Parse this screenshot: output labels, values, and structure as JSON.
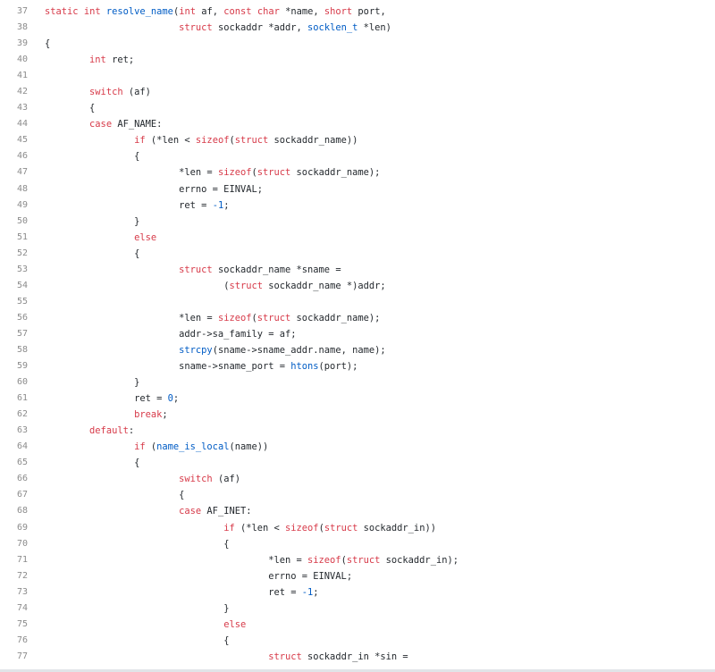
{
  "colors": {
    "keyword": "#d73a49",
    "function": "#005cc5",
    "number": "#005cc5",
    "plain": "#24292e",
    "line_number": "#8c8c8c"
  },
  "lines": [
    {
      "n": "37",
      "indent": "",
      "t": [
        [
          "kw",
          "static"
        ],
        [
          "p",
          " "
        ],
        [
          "kw",
          "int"
        ],
        [
          "p",
          " "
        ],
        [
          "fn",
          "resolve_name"
        ],
        [
          "p",
          "("
        ],
        [
          "kw",
          "int"
        ],
        [
          "p",
          " af, "
        ],
        [
          "kw",
          "const"
        ],
        [
          "p",
          " "
        ],
        [
          "kw",
          "char"
        ],
        [
          "p",
          " *name, "
        ],
        [
          "kw",
          "short"
        ],
        [
          "p",
          " port,"
        ]
      ]
    },
    {
      "n": "38",
      "indent": "\t\t\t",
      "t": [
        [
          "kw",
          "struct"
        ],
        [
          "p",
          " sockaddr *addr, "
        ],
        [
          "fn",
          "socklen_t"
        ],
        [
          "p",
          " *len)"
        ]
      ]
    },
    {
      "n": "39",
      "indent": "",
      "t": [
        [
          "p",
          "{"
        ]
      ]
    },
    {
      "n": "40",
      "indent": "\t",
      "t": [
        [
          "kw",
          "int"
        ],
        [
          "p",
          " ret;"
        ]
      ]
    },
    {
      "n": "41",
      "indent": "",
      "t": []
    },
    {
      "n": "42",
      "indent": "\t",
      "t": [
        [
          "kw",
          "switch"
        ],
        [
          "p",
          " (af)"
        ]
      ]
    },
    {
      "n": "43",
      "indent": "\t",
      "t": [
        [
          "p",
          "{"
        ]
      ]
    },
    {
      "n": "44",
      "indent": "\t",
      "t": [
        [
          "kw",
          "case"
        ],
        [
          "p",
          " AF_NAME:"
        ]
      ]
    },
    {
      "n": "45",
      "indent": "\t\t",
      "t": [
        [
          "kw",
          "if"
        ],
        [
          "p",
          " (*len < "
        ],
        [
          "kw",
          "sizeof"
        ],
        [
          "p",
          "("
        ],
        [
          "kw",
          "struct"
        ],
        [
          "p",
          " sockaddr_name))"
        ]
      ]
    },
    {
      "n": "46",
      "indent": "\t\t",
      "t": [
        [
          "p",
          "{"
        ]
      ]
    },
    {
      "n": "47",
      "indent": "\t\t\t",
      "t": [
        [
          "p",
          "*len = "
        ],
        [
          "kw",
          "sizeof"
        ],
        [
          "p",
          "("
        ],
        [
          "kw",
          "struct"
        ],
        [
          "p",
          " sockaddr_name);"
        ]
      ]
    },
    {
      "n": "48",
      "indent": "\t\t\t",
      "t": [
        [
          "p",
          "errno = EINVAL;"
        ]
      ]
    },
    {
      "n": "49",
      "indent": "\t\t\t",
      "t": [
        [
          "p",
          "ret = "
        ],
        [
          "num",
          "-1"
        ],
        [
          "p",
          ";"
        ]
      ]
    },
    {
      "n": "50",
      "indent": "\t\t",
      "t": [
        [
          "p",
          "}"
        ]
      ]
    },
    {
      "n": "51",
      "indent": "\t\t",
      "t": [
        [
          "kw",
          "else"
        ]
      ]
    },
    {
      "n": "52",
      "indent": "\t\t",
      "t": [
        [
          "p",
          "{"
        ]
      ]
    },
    {
      "n": "53",
      "indent": "\t\t\t",
      "t": [
        [
          "kw",
          "struct"
        ],
        [
          "p",
          " sockaddr_name *sname ="
        ]
      ]
    },
    {
      "n": "54",
      "indent": "\t\t\t\t",
      "t": [
        [
          "p",
          "("
        ],
        [
          "kw",
          "struct"
        ],
        [
          "p",
          " sockaddr_name *)addr;"
        ]
      ]
    },
    {
      "n": "55",
      "indent": "",
      "t": []
    },
    {
      "n": "56",
      "indent": "\t\t\t",
      "t": [
        [
          "p",
          "*len = "
        ],
        [
          "kw",
          "sizeof"
        ],
        [
          "p",
          "("
        ],
        [
          "kw",
          "struct"
        ],
        [
          "p",
          " sockaddr_name);"
        ]
      ]
    },
    {
      "n": "57",
      "indent": "\t\t\t",
      "t": [
        [
          "p",
          "addr->sa_family = af;"
        ]
      ]
    },
    {
      "n": "58",
      "indent": "\t\t\t",
      "t": [
        [
          "fn",
          "strcpy"
        ],
        [
          "p",
          "(sname->sname_addr.name, name);"
        ]
      ]
    },
    {
      "n": "59",
      "indent": "\t\t\t",
      "t": [
        [
          "p",
          "sname->sname_port = "
        ],
        [
          "fn",
          "htons"
        ],
        [
          "p",
          "(port);"
        ]
      ]
    },
    {
      "n": "60",
      "indent": "\t\t",
      "t": [
        [
          "p",
          "}"
        ]
      ]
    },
    {
      "n": "61",
      "indent": "\t\t",
      "t": [
        [
          "p",
          "ret = "
        ],
        [
          "num",
          "0"
        ],
        [
          "p",
          ";"
        ]
      ]
    },
    {
      "n": "62",
      "indent": "\t\t",
      "t": [
        [
          "kw",
          "break"
        ],
        [
          "p",
          ";"
        ]
      ]
    },
    {
      "n": "63",
      "indent": "\t",
      "t": [
        [
          "kw",
          "default"
        ],
        [
          "p",
          ":"
        ]
      ]
    },
    {
      "n": "64",
      "indent": "\t\t",
      "t": [
        [
          "kw",
          "if"
        ],
        [
          "p",
          " ("
        ],
        [
          "fn",
          "name_is_local"
        ],
        [
          "p",
          "(name))"
        ]
      ]
    },
    {
      "n": "65",
      "indent": "\t\t",
      "t": [
        [
          "p",
          "{"
        ]
      ]
    },
    {
      "n": "66",
      "indent": "\t\t\t",
      "t": [
        [
          "kw",
          "switch"
        ],
        [
          "p",
          " (af)"
        ]
      ]
    },
    {
      "n": "67",
      "indent": "\t\t\t",
      "t": [
        [
          "p",
          "{"
        ]
      ]
    },
    {
      "n": "68",
      "indent": "\t\t\t",
      "t": [
        [
          "kw",
          "case"
        ],
        [
          "p",
          " AF_INET:"
        ]
      ]
    },
    {
      "n": "69",
      "indent": "\t\t\t\t",
      "t": [
        [
          "kw",
          "if"
        ],
        [
          "p",
          " (*len < "
        ],
        [
          "kw",
          "sizeof"
        ],
        [
          "p",
          "("
        ],
        [
          "kw",
          "struct"
        ],
        [
          "p",
          " sockaddr_in))"
        ]
      ]
    },
    {
      "n": "70",
      "indent": "\t\t\t\t",
      "t": [
        [
          "p",
          "{"
        ]
      ]
    },
    {
      "n": "71",
      "indent": "\t\t\t\t\t",
      "t": [
        [
          "p",
          "*len = "
        ],
        [
          "kw",
          "sizeof"
        ],
        [
          "p",
          "("
        ],
        [
          "kw",
          "struct"
        ],
        [
          "p",
          " sockaddr_in);"
        ]
      ]
    },
    {
      "n": "72",
      "indent": "\t\t\t\t\t",
      "t": [
        [
          "p",
          "errno = EINVAL;"
        ]
      ]
    },
    {
      "n": "73",
      "indent": "\t\t\t\t\t",
      "t": [
        [
          "p",
          "ret = "
        ],
        [
          "num",
          "-1"
        ],
        [
          "p",
          ";"
        ]
      ]
    },
    {
      "n": "74",
      "indent": "\t\t\t\t",
      "t": [
        [
          "p",
          "}"
        ]
      ]
    },
    {
      "n": "75",
      "indent": "\t\t\t\t",
      "t": [
        [
          "kw",
          "else"
        ]
      ]
    },
    {
      "n": "76",
      "indent": "\t\t\t\t",
      "t": [
        [
          "p",
          "{"
        ]
      ]
    },
    {
      "n": "77",
      "indent": "\t\t\t\t\t",
      "t": [
        [
          "kw",
          "struct"
        ],
        [
          "p",
          " sockaddr_in *sin ="
        ]
      ]
    }
  ]
}
